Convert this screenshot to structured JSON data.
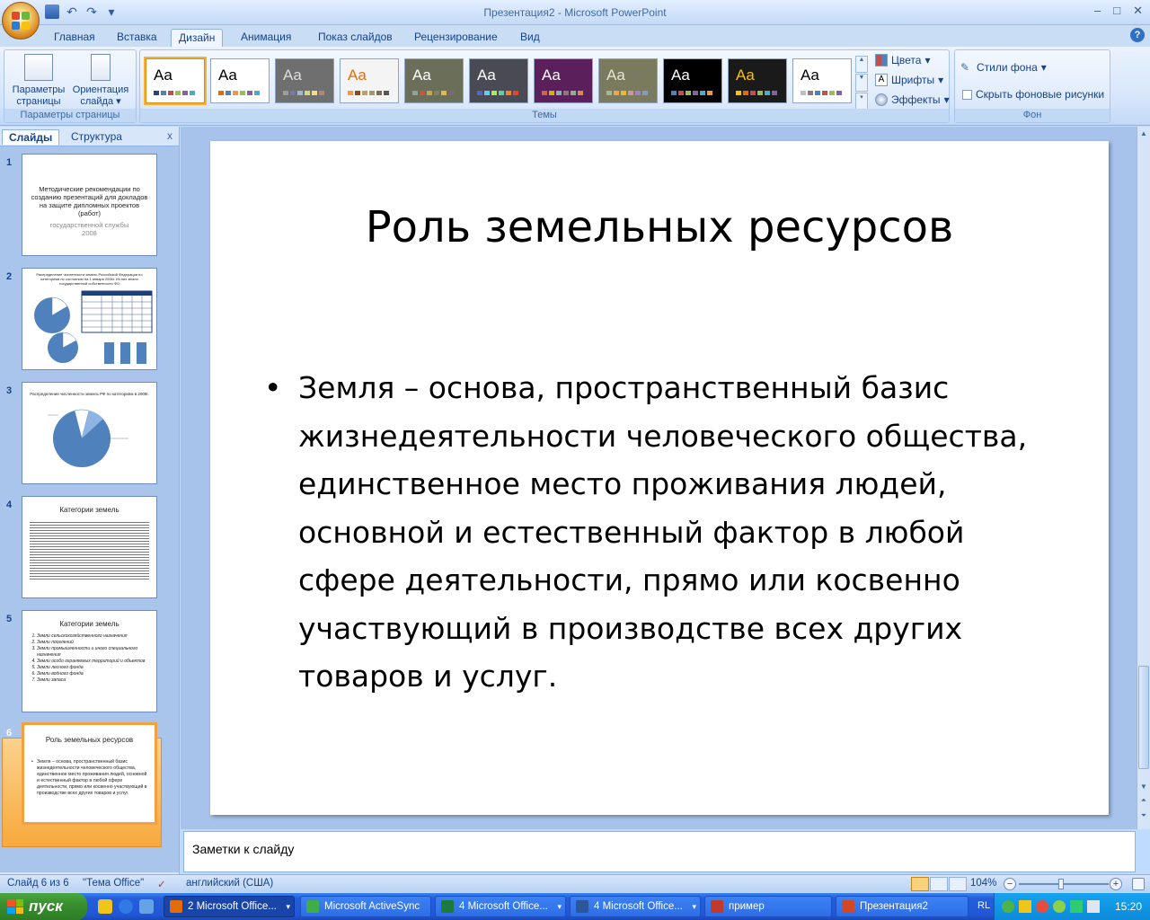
{
  "window": {
    "title": "Презентация2 - Microsoft PowerPoint",
    "controls": [
      "–",
      "□",
      "✕"
    ]
  },
  "ribbon_tabs": [
    "Главная",
    "Вставка",
    "Дизайн",
    "Анимация",
    "Показ слайдов",
    "Рецензирование",
    "Вид"
  ],
  "active_tab": "Дизайн",
  "page_setup": {
    "page_params_label": "Параметры страницы",
    "orientation_label": "Ориентация слайда",
    "group_label": "Параметры страницы"
  },
  "themes": {
    "group_label": "Темы",
    "sample": "Aa",
    "items": [
      {
        "bg": "#ffffff",
        "fg": "#000000",
        "sw": [
          "#1f497d",
          "#4f81bd",
          "#c0504d",
          "#9bbb59",
          "#8064a2",
          "#4bacc6"
        ]
      },
      {
        "bg": "#ffffff",
        "fg": "#000000",
        "sw": [
          "#e36c09",
          "#4f81bd",
          "#f79646",
          "#9bbb59",
          "#8064a2",
          "#4bacc6"
        ]
      },
      {
        "bg": "#6f6f6f",
        "fg": "#dddddd",
        "sw": [
          "#9c9c9c",
          "#727ca3",
          "#9fb8cd",
          "#d2da7a",
          "#fada7a",
          "#b88472"
        ]
      },
      {
        "bg": "#f4f4f4",
        "fg": "#e36c09",
        "sw": [
          "#f79646",
          "#8f4a14",
          "#bf9c68",
          "#9d9a6d",
          "#7a6f56",
          "#565656"
        ]
      },
      {
        "bg": "#6b6e58",
        "fg": "#ffffff",
        "sw": [
          "#93a299",
          "#cf543f",
          "#b5ae53",
          "#848058",
          "#e8b54d",
          "#786c71"
        ]
      },
      {
        "bg": "#4a4a55",
        "fg": "#ffffff",
        "sw": [
          "#4e67c8",
          "#5eccf3",
          "#a7ea52",
          "#5dceaf",
          "#ff8021",
          "#f14124"
        ]
      },
      {
        "bg": "#5b1f5b",
        "fg": "#ffffff",
        "sw": [
          "#d16349",
          "#ccb400",
          "#8cadae",
          "#8c7b70",
          "#8fb08c",
          "#d19049"
        ]
      },
      {
        "bg": "#7a7a5e",
        "fg": "#e9e6c8",
        "sw": [
          "#a5b592",
          "#f3a447",
          "#e7bc29",
          "#d092a7",
          "#9c85c0",
          "#809ec2"
        ]
      },
      {
        "bg": "#000000",
        "fg": "#ffffff",
        "sw": [
          "#4f81bd",
          "#c0504d",
          "#9bbb59",
          "#8064a2",
          "#4bacc6",
          "#f79646"
        ]
      },
      {
        "bg": "#1a1a1a",
        "fg": "#f8c200",
        "sw": [
          "#f8c200",
          "#e36c09",
          "#c0504d",
          "#9bbb59",
          "#4bacc6",
          "#8064a2"
        ]
      },
      {
        "bg": "#ffffff",
        "fg": "#000000",
        "sw": [
          "#bfbfbf",
          "#7f7f7f",
          "#4f81bd",
          "#c0504d",
          "#9bbb59",
          "#8064a2"
        ]
      }
    ],
    "colors_label": "Цвета",
    "fonts_label": "Шрифты",
    "effects_label": "Эффекты"
  },
  "background": {
    "group_label": "Фон",
    "styles_label": "Стили фона",
    "hide_label": "Скрыть фоновые рисунки"
  },
  "panel": {
    "tab_slides": "Слайды",
    "tab_outline": "Структура",
    "close": "x"
  },
  "thumbnails": [
    {
      "num": "1",
      "title": "Методические рекомендации по созданию презентаций для докладов на защите дипломных проектов (работ)",
      "sub": "государственной службы",
      "year": "2008"
    },
    {
      "num": "2",
      "title": "Распределение численности земель Российской Федерации по категориям по состоянию на 1 января 2008г. Из них земли государственной собственности ФО"
    },
    {
      "num": "3",
      "title": "Распределение численности земель РФ по категориям в 2008г."
    },
    {
      "num": "4",
      "title": "Категории земель"
    },
    {
      "num": "5",
      "title": "Категории земель",
      "items": [
        "Земли сельскохозяйственного назначения",
        "Земли поселений",
        "Земли промышленности и иного специального назначения",
        "Земли особо охраняемых территорий и объектов",
        "Земли лесного фонда",
        "Земли водного фонда",
        "Земли запаса"
      ]
    },
    {
      "num": "6",
      "title": "Роль земельных ресурсов",
      "body": "Земля – основа, пространственный базис жизнедеятельности человеческого общества, единственное место проживания людей, основной и естественный фактор в любой сфере деятельности, прямо или косвенно участвующий в производстве всех других товаров и услуг."
    }
  ],
  "slide": {
    "title": "Роль земельных ресурсов",
    "bullet": "•",
    "body": "Земля – основа, пространственный базис жизнедеятельности человеческого общества, единственное место проживания людей, основной и естественный фактор в любой сфере деятельности, прямо или косвенно участвующий в производстве всех других товаров и услуг."
  },
  "notes": {
    "placeholder": "Заметки к слайду"
  },
  "status": {
    "slide_info": "Слайд 6 из 6",
    "theme": "\"Тема Office\"",
    "language": "английский (США)",
    "zoom": "104%",
    "minus": "−",
    "plus": "+"
  },
  "taskbar": {
    "start": "пуск",
    "tasks": [
      {
        "label": "2 Microsoft Office...",
        "color": "#e36c09",
        "dd": "▾"
      },
      {
        "label": "Microsoft ActiveSync",
        "color": "#3fae49",
        "dd": ""
      },
      {
        "label": "4 Microsoft Office...",
        "color": "#1d7a3a",
        "dd": "▾"
      },
      {
        "label": "4 Microsoft Office...",
        "color": "#2b579a",
        "dd": "▾"
      },
      {
        "label": "пример",
        "color": "#c0392b",
        "dd": ""
      },
      {
        "label": "Презентация2",
        "color": "#d24726",
        "dd": ""
      }
    ],
    "lang": "RL",
    "time": "15:20"
  }
}
